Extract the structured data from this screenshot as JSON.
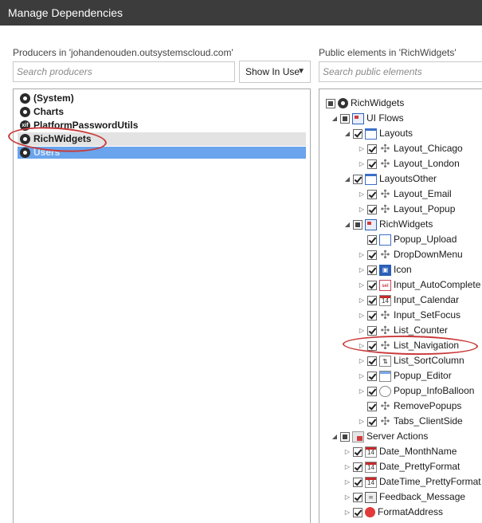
{
  "window": {
    "title": "Manage Dependencies"
  },
  "producers": {
    "label": "Producers in 'johandenouden.outsystemscloud.com'",
    "search_placeholder": "Search producers",
    "filter_selected": "Show In Use",
    "items": [
      {
        "label": "(System)",
        "icon": "module-icon"
      },
      {
        "label": "Charts",
        "icon": "module-icon"
      },
      {
        "label": "PlatformPasswordUtils",
        "icon": "extension-xif-icon"
      },
      {
        "label": "RichWidgets",
        "icon": "module-icon",
        "state": "highlighted"
      },
      {
        "label": "Users",
        "icon": "module-icon",
        "state": "selected"
      }
    ]
  },
  "elements": {
    "label": "Public elements in 'RichWidgets'",
    "search_placeholder": "Search public elements",
    "tree": [
      {
        "label": "RichWidgets",
        "icon": "module-icon",
        "level": 0
      },
      {
        "label": "UI Flows",
        "icon": "ui-flow-icon",
        "level": 1
      },
      {
        "label": "Layouts",
        "icon": "layout-folder-icon",
        "level": 2
      },
      {
        "label": "Layout_Chicago",
        "icon": "block-icon",
        "level": 3
      },
      {
        "label": "Layout_London",
        "icon": "block-icon",
        "level": 3
      },
      {
        "label": "LayoutsOther",
        "icon": "layout-folder-icon",
        "level": 2
      },
      {
        "label": "Layout_Email",
        "icon": "block-icon",
        "level": 3
      },
      {
        "label": "Layout_Popup",
        "icon": "block-icon",
        "level": 3
      },
      {
        "label": "RichWidgets",
        "icon": "flow-icon",
        "level": 2
      },
      {
        "label": "Popup_Upload",
        "icon": "screen-icon",
        "level": 3
      },
      {
        "label": "DropDownMenu",
        "icon": "block-icon",
        "level": 3
      },
      {
        "label": "Icon",
        "icon": "image-icon",
        "level": 3
      },
      {
        "label": "Input_AutoComplete",
        "icon": "autocomplete-icon",
        "level": 3
      },
      {
        "label": "Input_Calendar",
        "icon": "calendar-icon",
        "level": 3
      },
      {
        "label": "Input_SetFocus",
        "icon": "block-icon",
        "level": 3
      },
      {
        "label": "List_Counter",
        "icon": "block-icon",
        "level": 3
      },
      {
        "label": "List_Navigation",
        "icon": "block-icon",
        "level": 3
      },
      {
        "label": "List_SortColumn",
        "icon": "sort-icon",
        "level": 3
      },
      {
        "label": "Popup_Editor",
        "icon": "editor-icon",
        "level": 3
      },
      {
        "label": "Popup_InfoBalloon",
        "icon": "balloon-icon",
        "level": 3
      },
      {
        "label": "RemovePopups",
        "icon": "block-icon",
        "level": 3
      },
      {
        "label": "Tabs_ClientSide",
        "icon": "block-icon",
        "level": 3
      },
      {
        "label": "Server Actions",
        "icon": "server-actions-icon",
        "level": 1
      },
      {
        "label": "Date_MonthName",
        "icon": "calendar-icon",
        "level": 2
      },
      {
        "label": "Date_PrettyFormat",
        "icon": "calendar-icon",
        "level": 2
      },
      {
        "label": "DateTime_PrettyFormat",
        "icon": "calendar-icon",
        "level": 2
      },
      {
        "label": "Feedback_Message",
        "icon": "mail-icon",
        "level": 2
      },
      {
        "label": "FormatAddress",
        "icon": "action-icon",
        "level": 2
      }
    ]
  },
  "colors": {
    "titlebar": "#3c3c3c",
    "selection_blue": "#6aa4ec",
    "annotation_red": "#c93a3a"
  }
}
